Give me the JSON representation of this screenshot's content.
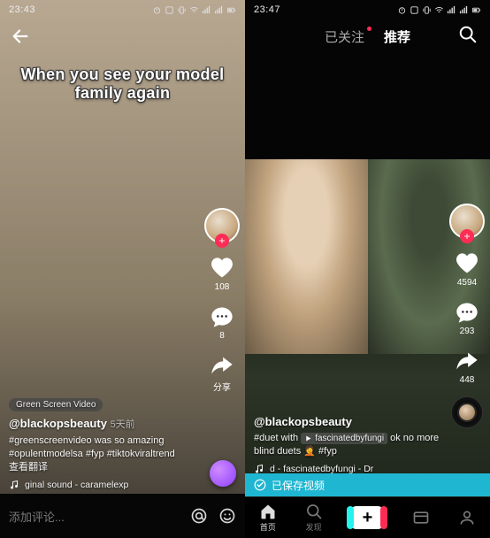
{
  "left": {
    "status": {
      "time": "23:43"
    },
    "caption_overlay": {
      "line1": "When you see your model",
      "line2": "family again"
    },
    "effect_pill": "Green Screen Video",
    "author": "@blackopsbeauty",
    "age": "5天前",
    "description": "#greenscreenvideo was so amazing #opulentmodelsa #fyp #tiktokviraltrend",
    "translate_hint": "查看翻译",
    "sound": "ginal sound - caramelexp",
    "rail": {
      "like_count": "108",
      "comment_count": "8",
      "share_label": "分享"
    },
    "comment_placeholder": "添加评论..."
  },
  "right": {
    "status": {
      "time": "23:47"
    },
    "tabs": {
      "following": "已关注",
      "recommend": "推荐"
    },
    "author": "@blackopsbeauty",
    "description_pre": "#duet with",
    "description_pill": "fascinatedbyfungi",
    "description_post": "ok no more blind duets 🤦 #fyp",
    "sound": "d - fascinatedbyfungi - Dr",
    "rail": {
      "like_count": "4594",
      "comment_count": "293",
      "share_count": "448"
    },
    "saved_banner": "已保存视频",
    "nav": {
      "home": "首页",
      "discover": "发现",
      "inbox": "",
      "me": ""
    }
  }
}
